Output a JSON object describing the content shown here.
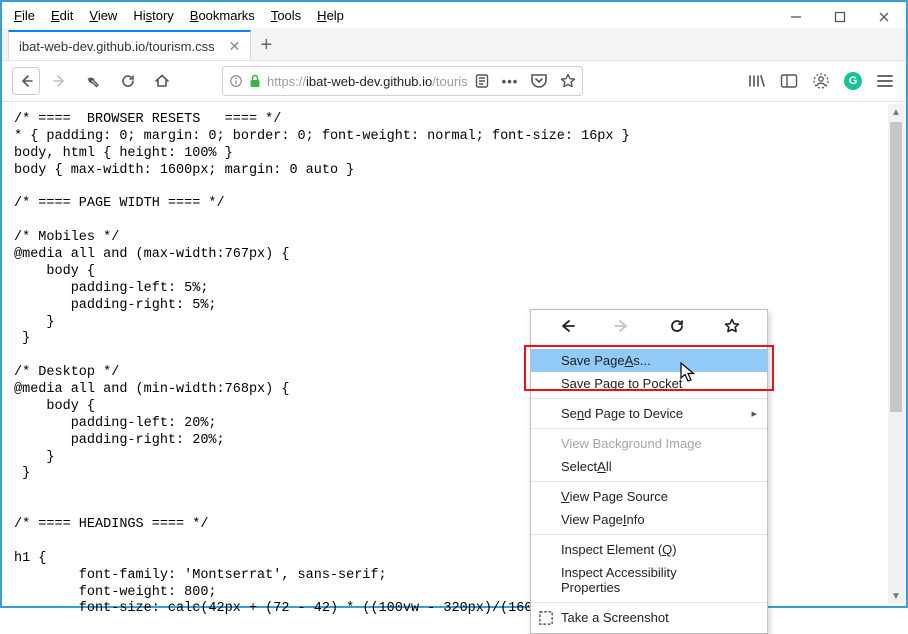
{
  "menubar": [
    "File",
    "Edit",
    "View",
    "History",
    "Bookmarks",
    "Tools",
    "Help"
  ],
  "tab": {
    "title": "ibat-web-dev.github.io/tourism.css"
  },
  "newtab_glyph": "+",
  "addressbar": {
    "proto": "https://",
    "host": "ibat-web-dev.github.io",
    "path": "/touris"
  },
  "code": "/* ====  BROWSER RESETS   ==== */\n* { padding: 0; margin: 0; border: 0; font-weight: normal; font-size: 16px }\nbody, html { height: 100% }\nbody { max-width: 1600px; margin: 0 auto }\n\n/* ==== PAGE WIDTH ==== */\n\n/* Mobiles */\n@media all and (max-width:767px) {\n    body {\n       padding-left: 5%;\n       padding-right: 5%;\n    }\n }\n\n/* Desktop */\n@media all and (min-width:768px) {\n    body {\n       padding-left: 20%;\n       padding-right: 20%;\n    }\n }\n\n\n/* ==== HEADINGS ==== */\n\nh1 {\n        font-family: 'Montserrat', sans-serif;\n        font-weight: 800;\n        font-size: calc(42px + (72 - 42) * ((100vw - 320px)/(160",
  "context_menu": {
    "save_page_as": "Save Page As...",
    "save_to_pocket": "Save Page to Pocket",
    "send_to_device": "Send Page to Device",
    "view_bg_image": "View Background Image",
    "select_all": "Select All",
    "view_source": "View Page Source",
    "view_info": "View Page Info",
    "inspect_element": "Inspect Element (",
    "inspect_element_key": "Q",
    "inspect_element_suffix": ")",
    "inspect_a11y": "Inspect Accessibility Properties",
    "screenshot": "Take a Screenshot"
  }
}
